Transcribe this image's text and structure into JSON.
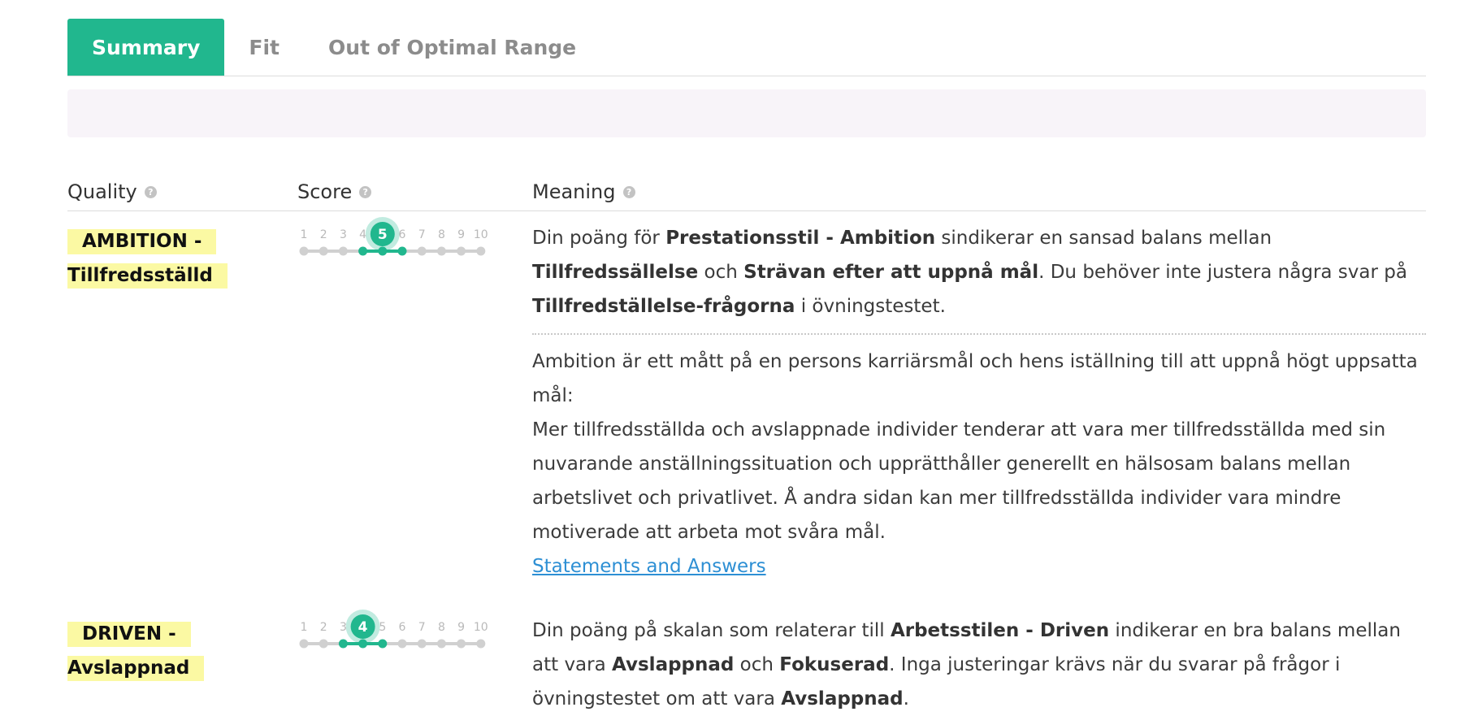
{
  "tabs": [
    {
      "label": "Summary",
      "active": true
    },
    {
      "label": "Fit",
      "active": false
    },
    {
      "label": "Out of Optimal Range",
      "active": false
    }
  ],
  "columns": {
    "quality": "Quality",
    "score": "Score",
    "meaning": "Meaning",
    "help_glyph": "?"
  },
  "score_scale": [
    "1",
    "2",
    "3",
    "4",
    "5",
    "6",
    "7",
    "8",
    "9",
    "10"
  ],
  "colors": {
    "accent": "#21b78e",
    "track": "#d0d0d0",
    "highlight": "#fbf9a3",
    "link": "#2d8fd4"
  },
  "rows": [
    {
      "quality_line1": "AMBITION -",
      "quality_line2": "Tillfredsställd",
      "score": 5,
      "range": [
        4,
        6
      ],
      "meaning_parts": [
        "Din poäng för ",
        "Prestationsstil - Ambition",
        " sindikerar en sansad balans mellan ",
        "Tillfredssällelse",
        " och ",
        "Strävan efter att uppnå mål",
        ". Du behöver inte justera några svar på ",
        "Tillfredställelse-frågorna",
        " i övningstestet."
      ],
      "description_1": "Ambition är ett mått på en persons karriärsmål och hens iställning till att uppnå högt uppsatta mål:",
      "description_2": "Mer tillfredsställda och avslappnade individer tenderar att vara mer tillfredsställda med sin nuvarande anställningssituation och upprätthåller generellt en hälsosam balans mellan arbetslivet och privatlivet. Å andra sidan kan mer tillfredsställda individer vara mindre motiverade att arbeta mot svåra mål.",
      "link": "Statements and Answers"
    },
    {
      "quality_line1": "DRIVEN -",
      "quality_line2": "Avslappnad",
      "score": 4,
      "range": [
        3,
        5
      ],
      "meaning_parts": [
        "Din poäng på skalan som relaterar till ",
        "Arbetsstilen - Driven",
        " indikerar en bra balans mellan att vara ",
        "Avslappnad",
        " och ",
        "Fokuserad",
        ". Inga justeringar krävs när du svarar på frågor i övningstestet om att vara ",
        "Avslappnad",
        "."
      ]
    }
  ]
}
